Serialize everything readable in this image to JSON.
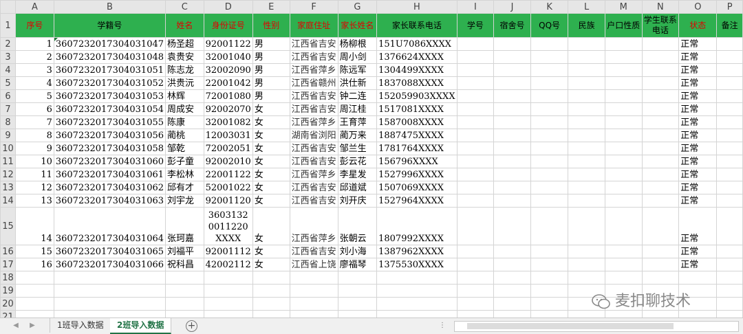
{
  "columns": [
    "A",
    "B",
    "C",
    "D",
    "E",
    "F",
    "G",
    "H",
    "I",
    "J",
    "K",
    "L",
    "M",
    "N",
    "O",
    "P"
  ],
  "header": [
    {
      "text": "序号",
      "red": true
    },
    {
      "text": "学籍号",
      "red": false
    },
    {
      "text": "姓名",
      "red": true
    },
    {
      "text": "身份证号",
      "red": true
    },
    {
      "text": "性别",
      "red": true
    },
    {
      "text": "家庭住址",
      "red": true
    },
    {
      "text": "家长姓名",
      "red": true
    },
    {
      "text": "家长联系电话",
      "red": false
    },
    {
      "text": "学号",
      "red": false
    },
    {
      "text": "宿舍号",
      "red": false
    },
    {
      "text": "QQ号",
      "red": false
    },
    {
      "text": "民族",
      "red": false
    },
    {
      "text": "户口性质",
      "red": false
    },
    {
      "text": "学生联系电话",
      "red": false
    },
    {
      "text": "状态",
      "red": true
    },
    {
      "text": "备注",
      "red": false
    }
  ],
  "rows": [
    {
      "no": "1",
      "xj": "3607232017304031047",
      "name": "杨圣超",
      "id": "92001122",
      "sex": "男",
      "addr": "江西省吉安",
      "parent": "杨柳根",
      "phone": "151U7086XXXX",
      "status": "正常"
    },
    {
      "no": "2",
      "xj": "3607232017304031048",
      "name": "袁贵安",
      "id": "32001040",
      "sex": "男",
      "addr": "江西省吉安",
      "parent": "周小剑",
      "phone": "1376624XXXX",
      "status": "正常"
    },
    {
      "no": "3",
      "xj": "3607232017304031051",
      "name": "陈志龙",
      "id": "32002090",
      "sex": "男",
      "addr": "江西省萍乡",
      "parent": "陈远军",
      "phone": "1304499XXXX",
      "status": "正常"
    },
    {
      "no": "4",
      "xj": "3607232017304031052",
      "name": "洪贵沅",
      "id": "22001042",
      "sex": "男",
      "addr": "江西省赣州",
      "parent": "洪仕新",
      "phone": "1837088XXXX",
      "status": "正常"
    },
    {
      "no": "5",
      "xj": "3607232017304031053",
      "name": "林辉",
      "id": "72001080",
      "sex": "男",
      "addr": "江西省吉安",
      "parent": "钟二连",
      "phone": "152059903XXXX",
      "status": "正常"
    },
    {
      "no": "6",
      "xj": "3607232017304031054",
      "name": "周成安",
      "id": "92002070",
      "sex": "女",
      "addr": "江西省吉安",
      "parent": "周江桂",
      "phone": "1517081XXXX",
      "status": "正常"
    },
    {
      "no": "7",
      "xj": "3607232017304031055",
      "name": "陈康",
      "id": "32001082",
      "sex": "女",
      "addr": "江西省萍乡",
      "parent": "王育萍",
      "phone": "1587008XXXX",
      "status": "正常"
    },
    {
      "no": "8",
      "xj": "3607232017304031056",
      "name": "蔺桃",
      "id": "12003031",
      "sex": "女",
      "addr": "湖南省浏阳",
      "parent": "蔺万来",
      "phone": "1887475XXXX",
      "status": "正常"
    },
    {
      "no": "9",
      "xj": "3607232017304031058",
      "name": "邹乾",
      "id": "72002051",
      "sex": "女",
      "addr": "江西省吉安",
      "parent": "邹兰生",
      "phone": "1781764XXXX",
      "status": "正常"
    },
    {
      "no": "10",
      "xj": "3607232017304031060",
      "name": "彭子童",
      "id": "92002010",
      "sex": "女",
      "addr": "江西省吉安",
      "parent": "彭云花",
      "phone": "156796XXXX",
      "status": "正常"
    },
    {
      "no": "11",
      "xj": "3607232017304031061",
      "name": "李松林",
      "id": "22001122",
      "sex": "女",
      "addr": "江西省萍乡",
      "parent": "李星发",
      "phone": "1527996XXXX",
      "status": "正常"
    },
    {
      "no": "12",
      "xj": "3607232017304031062",
      "name": "邱有才",
      "id": "52001022",
      "sex": "女",
      "addr": "江西省吉安",
      "parent": "邱道斌",
      "phone": "1507069XXXX",
      "status": "正常"
    },
    {
      "no": "13",
      "xj": "3607232017304031063",
      "name": "刘宇龙",
      "id": "92001120",
      "sex": "女",
      "addr": "江西省吉安",
      "parent": "刘开庆",
      "phone": "1527964XXXX",
      "status": "正常"
    },
    {
      "no": "14",
      "xj": "3607232017304031064",
      "name": "张珂嘉",
      "id": "3603132 0011220 XXXX",
      "sex": "女",
      "addr": "江西省萍乡",
      "parent": "张朝云",
      "phone": "1807992XXXX",
      "status": "正常",
      "tall": true
    },
    {
      "no": "15",
      "xj": "3607232017304031065",
      "name": "刘福平",
      "id": "92001112",
      "sex": "女",
      "addr": "江西省吉安",
      "parent": "刘小海",
      "phone": "1387962XXXX",
      "status": "正常"
    },
    {
      "no": "16",
      "xj": "3607232017304031066",
      "name": "祝科昌",
      "id": "42002112",
      "sex": "女",
      "addr": "江西省上饶",
      "parent": "廖福琴",
      "phone": "1375530XXXX",
      "status": "正常"
    }
  ],
  "row_numbers": [
    "1",
    "2",
    "3",
    "4",
    "5",
    "6",
    "7",
    "8",
    "9",
    "10",
    "11",
    "12",
    "13",
    "14",
    "15",
    "16",
    "17",
    "18",
    "19",
    "20",
    "21"
  ],
  "tabs": [
    "1班导入数据",
    "2班导入数据"
  ],
  "active_tab": 1,
  "watermark": "麦扣聊技术",
  "accent_color": "#2eb04f",
  "header_red_color": "#e00000"
}
